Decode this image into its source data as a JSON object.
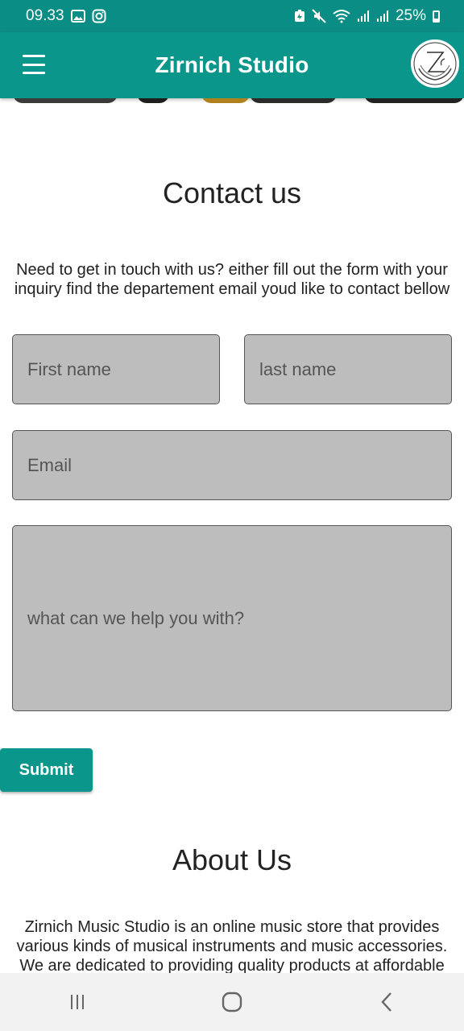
{
  "status_bar": {
    "time": "09.33",
    "battery": "25%"
  },
  "app_bar": {
    "title": "Zirnich Studio",
    "logo_text": "Z.ch"
  },
  "contact": {
    "title": "Contact us",
    "intro_line1": "Need to get in touch with us? either fill out the form with your",
    "intro_line2": "inquiry find the departement email youd like to contact bellow",
    "first_name_placeholder": "First name",
    "last_name_placeholder": "last name",
    "email_placeholder": "Email",
    "message_placeholder": "what can we help you with?",
    "submit_label": "Submit"
  },
  "about": {
    "title": "About Us",
    "line1": "Zirnich Music Studio is an online music store that provides",
    "line2": "various kinds of musical instruments and music accessories.",
    "line3": "We are dedicated to providing quality products at affordable"
  },
  "colors": {
    "primary": "#0a968b",
    "status_bar": "#0a8d84",
    "field_bg": "#bdbdbd"
  }
}
